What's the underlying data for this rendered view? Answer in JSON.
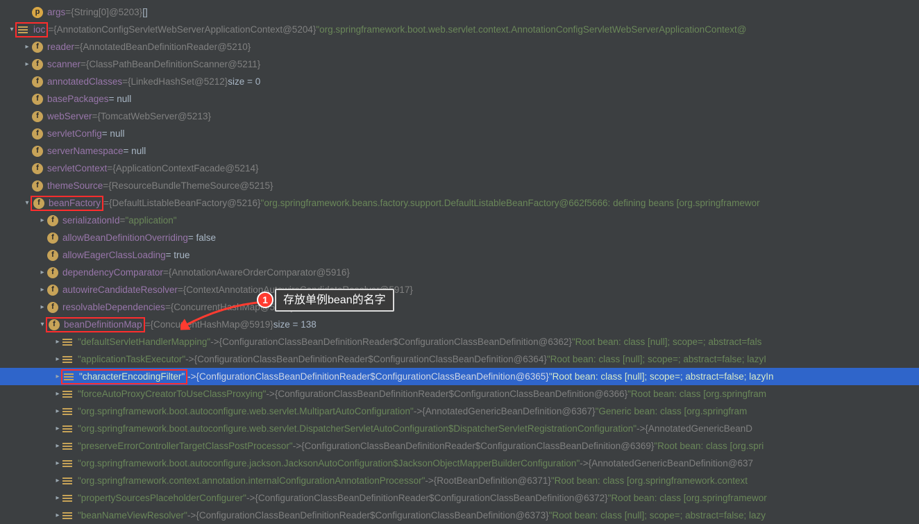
{
  "callout": {
    "badge": "1",
    "text": "存放单例bean的名字"
  },
  "rows": [
    {
      "level": 1,
      "chev": "",
      "icon": "p",
      "name": "args",
      "eqref": "{String[0]@5203}",
      "trail": " []"
    },
    {
      "level": 0,
      "chev": "down",
      "icon": "list",
      "name": "ioc",
      "eqref": "{AnnotationConfigServletWebServerApplicationContext@5204}",
      "strval": "\"org.springframework.boot.web.servlet.context.AnnotationConfigServletWebServerApplicationContext@",
      "redboxName": true
    },
    {
      "level": 1,
      "chev": "right",
      "icon": "f",
      "name": "reader",
      "eqref": "{AnnotatedBeanDefinitionReader@5210}"
    },
    {
      "level": 1,
      "chev": "right",
      "icon": "f",
      "name": "scanner",
      "eqref": "{ClassPathBeanDefinitionScanner@5211}"
    },
    {
      "level": 1,
      "chev": "",
      "icon": "f",
      "name": "annotatedClasses",
      "eqref": "{LinkedHashSet@5212}",
      "trail": "  size = 0"
    },
    {
      "level": 1,
      "chev": "",
      "icon": "f",
      "name": "basePackages",
      "literal_after": " = null"
    },
    {
      "level": 1,
      "chev": "",
      "icon": "f",
      "name": "webServer",
      "eqref": "{TomcatWebServer@5213}"
    },
    {
      "level": 1,
      "chev": "",
      "icon": "f",
      "name": "servletConfig",
      "literal_after": " = null"
    },
    {
      "level": 1,
      "chev": "",
      "icon": "f",
      "name": "serverNamespace",
      "literal_after": " = null"
    },
    {
      "level": 1,
      "chev": "",
      "icon": "f",
      "name": "servletContext",
      "eqref": "{ApplicationContextFacade@5214}"
    },
    {
      "level": 1,
      "chev": "",
      "icon": "f",
      "name": "themeSource",
      "eqref": "{ResourceBundleThemeSource@5215}"
    },
    {
      "level": 1,
      "chev": "down",
      "icon": "f",
      "name": "beanFactory",
      "eqref": "{DefaultListableBeanFactory@5216}",
      "strval": "\"org.springframework.beans.factory.support.DefaultListableBeanFactory@662f5666: defining beans [org.springframewor",
      "redboxName": true
    },
    {
      "level": 2,
      "chev": "right",
      "icon": "f",
      "name": "serializationId",
      "eqstr": "\"application\""
    },
    {
      "level": 2,
      "chev": "",
      "icon": "f",
      "name": "allowBeanDefinitionOverriding",
      "literal_after": " = false"
    },
    {
      "level": 2,
      "chev": "",
      "icon": "f",
      "name": "allowEagerClassLoading",
      "literal_after": " = true"
    },
    {
      "level": 2,
      "chev": "right",
      "icon": "f",
      "name": "dependencyComparator",
      "eqref": "{AnnotationAwareOrderComparator@5916}"
    },
    {
      "level": 2,
      "chev": "right",
      "icon": "f",
      "name": "autowireCandidateResolver",
      "eqref": "{ContextAnnotationAutowireCandidateResolver@5917}"
    },
    {
      "level": 2,
      "chev": "right",
      "icon": "f",
      "name": "resolvableDependencies",
      "eqref": "{ConcurrentHashMap@5918}",
      "trail": "  size = 6"
    },
    {
      "level": 2,
      "chev": "down",
      "icon": "f",
      "name": "beanDefinitionMap",
      "eqref": "{ConcurrentHashMap@5919}",
      "trail": "  size = 138",
      "redboxName": true
    },
    {
      "level": 3,
      "chev": "right",
      "icon": "list",
      "keystr": "\"defaultServletHandlerMapping\"",
      "arrowref": "{ConfigurationClassBeanDefinitionReader$ConfigurationClassBeanDefinition@6362}",
      "strval": "\"Root bean: class [null]; scope=; abstract=fals"
    },
    {
      "level": 3,
      "chev": "right",
      "icon": "list",
      "keystr": "\"applicationTaskExecutor\"",
      "arrowref": "{ConfigurationClassBeanDefinitionReader$ConfigurationClassBeanDefinition@6364}",
      "strval": "\"Root bean: class [null]; scope=; abstract=false; lazyI"
    },
    {
      "level": 3,
      "chev": "right",
      "icon": "list",
      "keystr": "\"characterEncodingFilter\"",
      "arrowref": "{ConfigurationClassBeanDefinitionReader$ConfigurationClassBeanDefinition@6365}",
      "strval": "\"Root bean: class [null]; scope=; abstract=false; lazyIn",
      "selected": true,
      "redboxKey": true
    },
    {
      "level": 3,
      "chev": "right",
      "icon": "list",
      "keystr": "\"forceAutoProxyCreatorToUseClassProxying\"",
      "arrowref": "{ConfigurationClassBeanDefinitionReader$ConfigurationClassBeanDefinition@6366}",
      "strval": "\"Root bean: class [org.springfram"
    },
    {
      "level": 3,
      "chev": "right",
      "icon": "list",
      "keystr": "\"org.springframework.boot.autoconfigure.web.servlet.MultipartAutoConfiguration\"",
      "arrowref": "{AnnotatedGenericBeanDefinition@6367}",
      "strval": "\"Generic bean: class [org.springfram"
    },
    {
      "level": 3,
      "chev": "right",
      "icon": "list",
      "keystr": "\"org.springframework.boot.autoconfigure.web.servlet.DispatcherServletAutoConfiguration$DispatcherServletRegistrationConfiguration\"",
      "arrowref": "{AnnotatedGenericBeanD"
    },
    {
      "level": 3,
      "chev": "right",
      "icon": "list",
      "keystr": "\"preserveErrorControllerTargetClassPostProcessor\"",
      "arrowref": "{ConfigurationClassBeanDefinitionReader$ConfigurationClassBeanDefinition@6369}",
      "strval": "\"Root bean: class [org.spri"
    },
    {
      "level": 3,
      "chev": "right",
      "icon": "list",
      "keystr": "\"org.springframework.boot.autoconfigure.jackson.JacksonAutoConfiguration$JacksonObjectMapperBuilderConfiguration\"",
      "arrowref": "{AnnotatedGenericBeanDefinition@637"
    },
    {
      "level": 3,
      "chev": "right",
      "icon": "list",
      "keystr": "\"org.springframework.context.annotation.internalConfigurationAnnotationProcessor\"",
      "arrowref": "{RootBeanDefinition@6371}",
      "strval": "\"Root bean: class [org.springframework.context"
    },
    {
      "level": 3,
      "chev": "right",
      "icon": "list",
      "keystr": "\"propertySourcesPlaceholderConfigurer\"",
      "arrowref": "{ConfigurationClassBeanDefinitionReader$ConfigurationClassBeanDefinition@6372}",
      "strval": "\"Root bean: class [org.springframewor"
    },
    {
      "level": 3,
      "chev": "right",
      "icon": "list",
      "keystr": "\"beanNameViewResolver\"",
      "arrowref": "{ConfigurationClassBeanDefinitionReader$ConfigurationClassBeanDefinition@6373}",
      "strval": "\"Root bean: class [null]; scope=; abstract=false; lazy"
    }
  ]
}
